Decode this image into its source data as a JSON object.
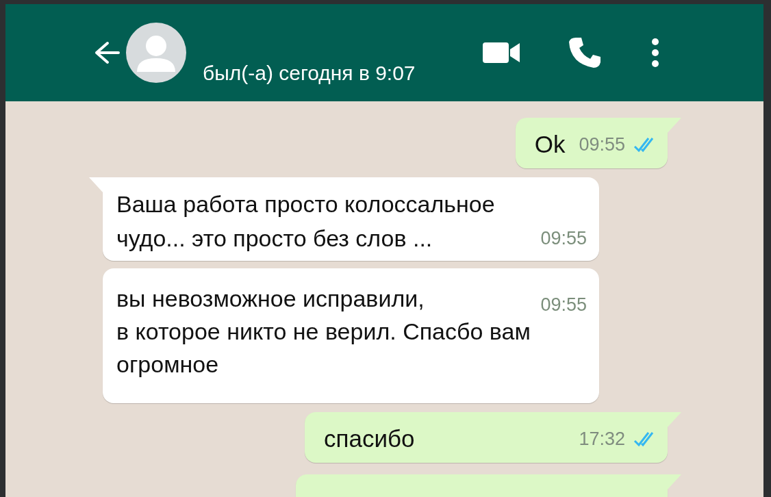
{
  "header": {
    "status": "был(-а) сегодня в 9:07"
  },
  "messages": [
    {
      "kind": "outgoing",
      "text": "Ok",
      "time": "09:55",
      "read": true
    },
    {
      "kind": "incoming",
      "text": "Ваша работа просто колоссальное\nчудо... это просто без слов ...",
      "time": "09:55"
    },
    {
      "kind": "incoming",
      "text": "вы невозможное исправили,\nв которое никто не верил. Спасбо вам\nогромное",
      "time": "09:55",
      "continued": true
    },
    {
      "kind": "outgoing",
      "text": "спасибо",
      "time": "17:32",
      "read": true
    },
    {
      "kind": "outgoing"
    }
  ]
}
